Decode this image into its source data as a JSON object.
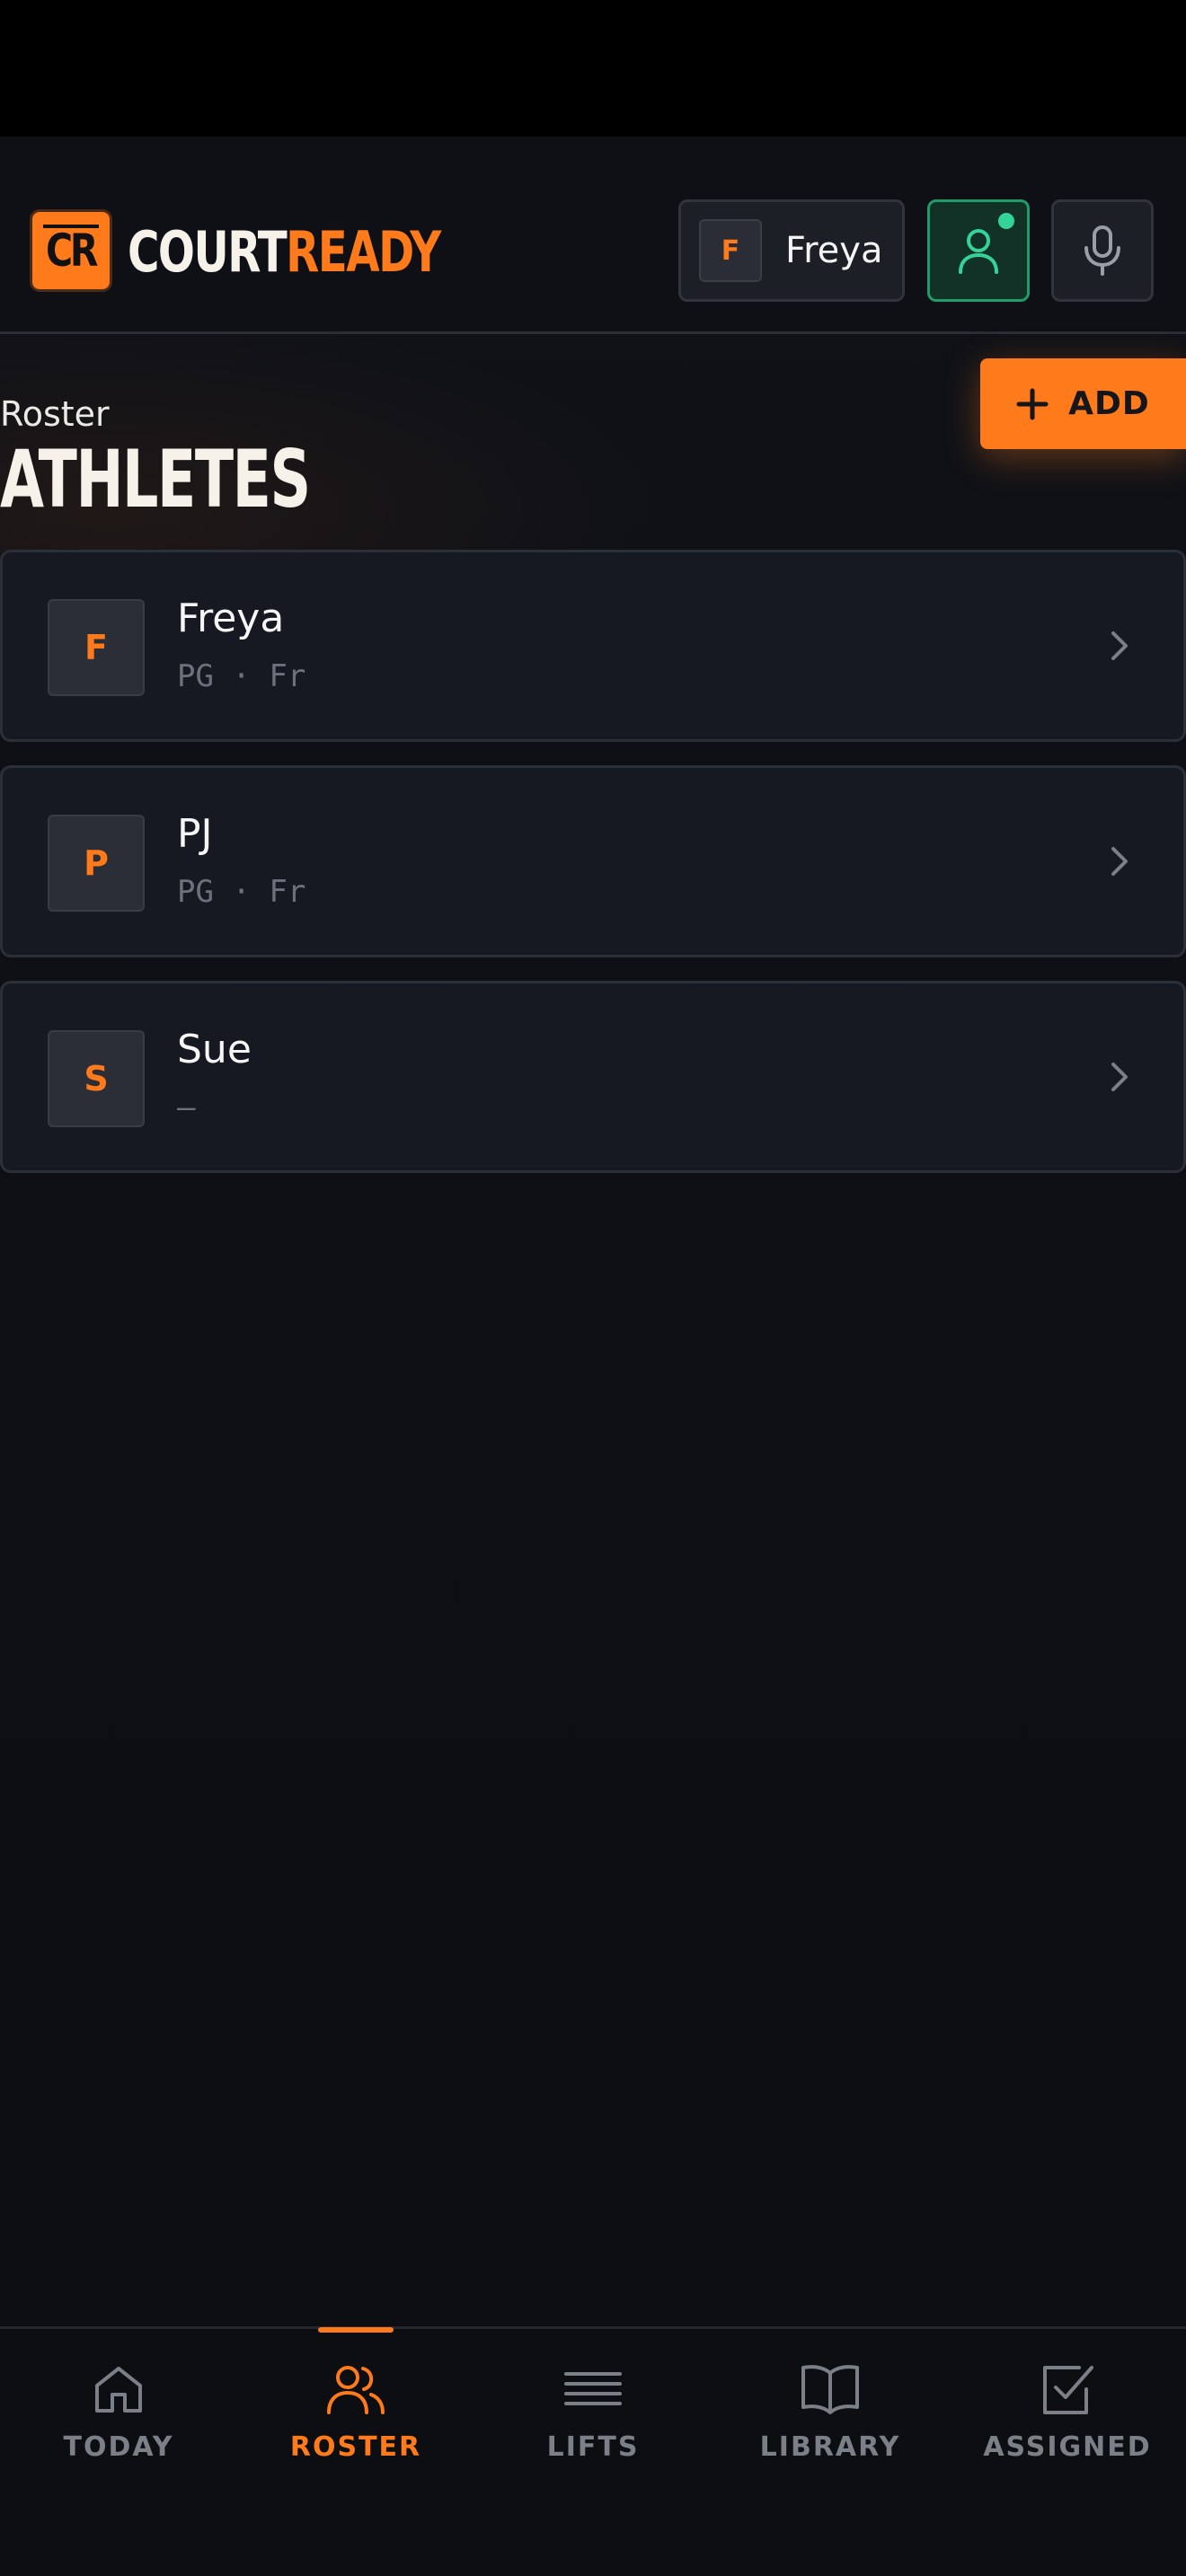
{
  "brand": {
    "logo_text": "CR",
    "name_part1": "COURT",
    "name_part2": "READY"
  },
  "header": {
    "selected_athlete": {
      "initial": "F",
      "name": "Freya"
    },
    "profile_icon": "user-icon",
    "mic_icon": "microphone-icon"
  },
  "page": {
    "subtitle": "Roster",
    "title": "ATHLETES",
    "add_label": "ADD"
  },
  "athletes": [
    {
      "initial": "F",
      "name": "Freya",
      "meta": "PG · Fr"
    },
    {
      "initial": "P",
      "name": "PJ",
      "meta": "PG · Fr"
    },
    {
      "initial": "S",
      "name": "Sue",
      "meta": "—"
    }
  ],
  "nav": {
    "items": [
      {
        "label": "TODAY",
        "icon": "home-icon"
      },
      {
        "label": "ROSTER",
        "icon": "users-icon"
      },
      {
        "label": "LIFTS",
        "icon": "list-icon"
      },
      {
        "label": "LIBRARY",
        "icon": "book-icon"
      },
      {
        "label": "ASSIGNED",
        "icon": "checkbox-icon"
      }
    ],
    "active": "ROSTER"
  },
  "colors": {
    "accent": "#ff7a1a",
    "online": "#34d399",
    "background": "#0c0e13"
  }
}
